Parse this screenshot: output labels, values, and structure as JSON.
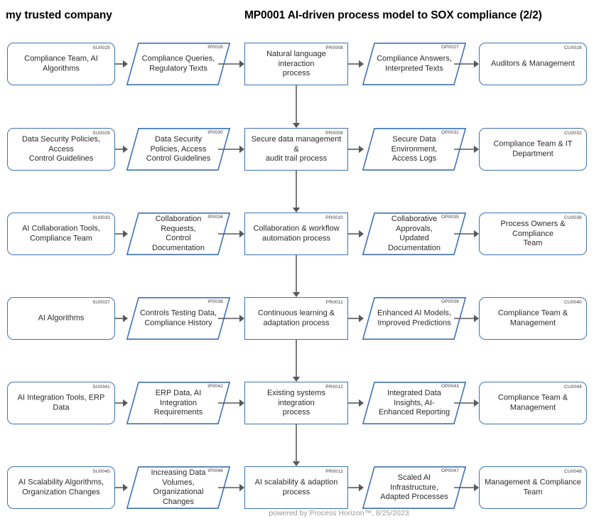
{
  "header": {
    "company_title": "my trusted company",
    "model_title": "MP0001 AI-driven process model to SOX compliance (2/2)"
  },
  "footer": {
    "text": "powered by Process Horizon™, 8/25/2023"
  },
  "colors": {
    "node_border": "#3f72b5",
    "connector": "#595959",
    "text": "#262626",
    "code_text": "#3a3a3a",
    "footer_text": "#9a9a9a",
    "background": "#ffffff"
  },
  "columns": [
    {
      "key": "supplier",
      "shape": "rounded-rectangle"
    },
    {
      "key": "input",
      "shape": "parallelogram"
    },
    {
      "key": "process",
      "shape": "rectangle"
    },
    {
      "key": "output",
      "shape": "parallelogram"
    },
    {
      "key": "customer",
      "shape": "rounded-rectangle"
    }
  ],
  "rows": [
    {
      "supplier": {
        "code": "SU0025",
        "label": "Compliance Team, AI Algorithms"
      },
      "input": {
        "code": "IP0026",
        "label": "Compliance Queries,\nRegulatory Texts"
      },
      "process": {
        "code": "PR0008",
        "label": "Natural language interaction\nprocess"
      },
      "output": {
        "code": "OP0027",
        "label": "Compliance Answers,\nInterpreted Texts"
      },
      "customer": {
        "code": "CU0028",
        "label": "Auditors & Management"
      }
    },
    {
      "supplier": {
        "code": "SU0029",
        "label": "Data Security Policies, Access\nControl Guidelines"
      },
      "input": {
        "code": "IP0030",
        "label": "Data Security Policies, Access\nControl Guidelines"
      },
      "process": {
        "code": "PR0009",
        "label": "Secure data management &\naudit trail process"
      },
      "output": {
        "code": "OP0031",
        "label": "Secure Data Environment,\nAccess Logs"
      },
      "customer": {
        "code": "CU0032",
        "label": "Compliance Team & IT\nDepartment"
      }
    },
    {
      "supplier": {
        "code": "SU0033",
        "label": "AI Collaboration Tools,\nCompliance Team"
      },
      "input": {
        "code": "IP0034",
        "label": "Collaboration Requests,\nControl Documentation"
      },
      "process": {
        "code": "PR0010",
        "label": "Collaboration & workflow\nautomation process"
      },
      "output": {
        "code": "OP0035",
        "label": "Collaborative Approvals,\nUpdated Documentation"
      },
      "customer": {
        "code": "CU0036",
        "label": "Process Owners & Compliance\nTeam"
      }
    },
    {
      "supplier": {
        "code": "SU0037",
        "label": "AI Algorithms"
      },
      "input": {
        "code": "IP0038",
        "label": "Controls Testing Data,\nCompliance History"
      },
      "process": {
        "code": "PR0011",
        "label": "Continuous learning &\nadaptation process"
      },
      "output": {
        "code": "OP0039",
        "label": "Enhanced AI Models,\nImproved Predictions"
      },
      "customer": {
        "code": "CU0040",
        "label": "Compliance Team &\nManagement"
      }
    },
    {
      "supplier": {
        "code": "SU0041",
        "label": "AI Integration Tools, ERP Data"
      },
      "input": {
        "code": "IP0042",
        "label": "ERP Data, AI Integration\nRequirements"
      },
      "process": {
        "code": "PR0012",
        "label": "Existing systems integration\nprocess"
      },
      "output": {
        "code": "OP0043",
        "label": "Integrated Data Insights, AI-\nEnhanced Reporting"
      },
      "customer": {
        "code": "CU0044",
        "label": "Compliance Team &\nManagement"
      }
    },
    {
      "supplier": {
        "code": "SU0045",
        "label": "AI Scalability Algorithms,\nOrganization Changes"
      },
      "input": {
        "code": "IP0046",
        "label": "Increasing Data Volumes,\nOrganizational Changes"
      },
      "process": {
        "code": "PR0013",
        "label": "AI scalability & adaption process"
      },
      "output": {
        "code": "OP0047",
        "label": "Scaled AI Infrastructure,\nAdapted Processes"
      },
      "customer": {
        "code": "CU0048",
        "label": "Management & Compliance\nTeam"
      }
    }
  ]
}
